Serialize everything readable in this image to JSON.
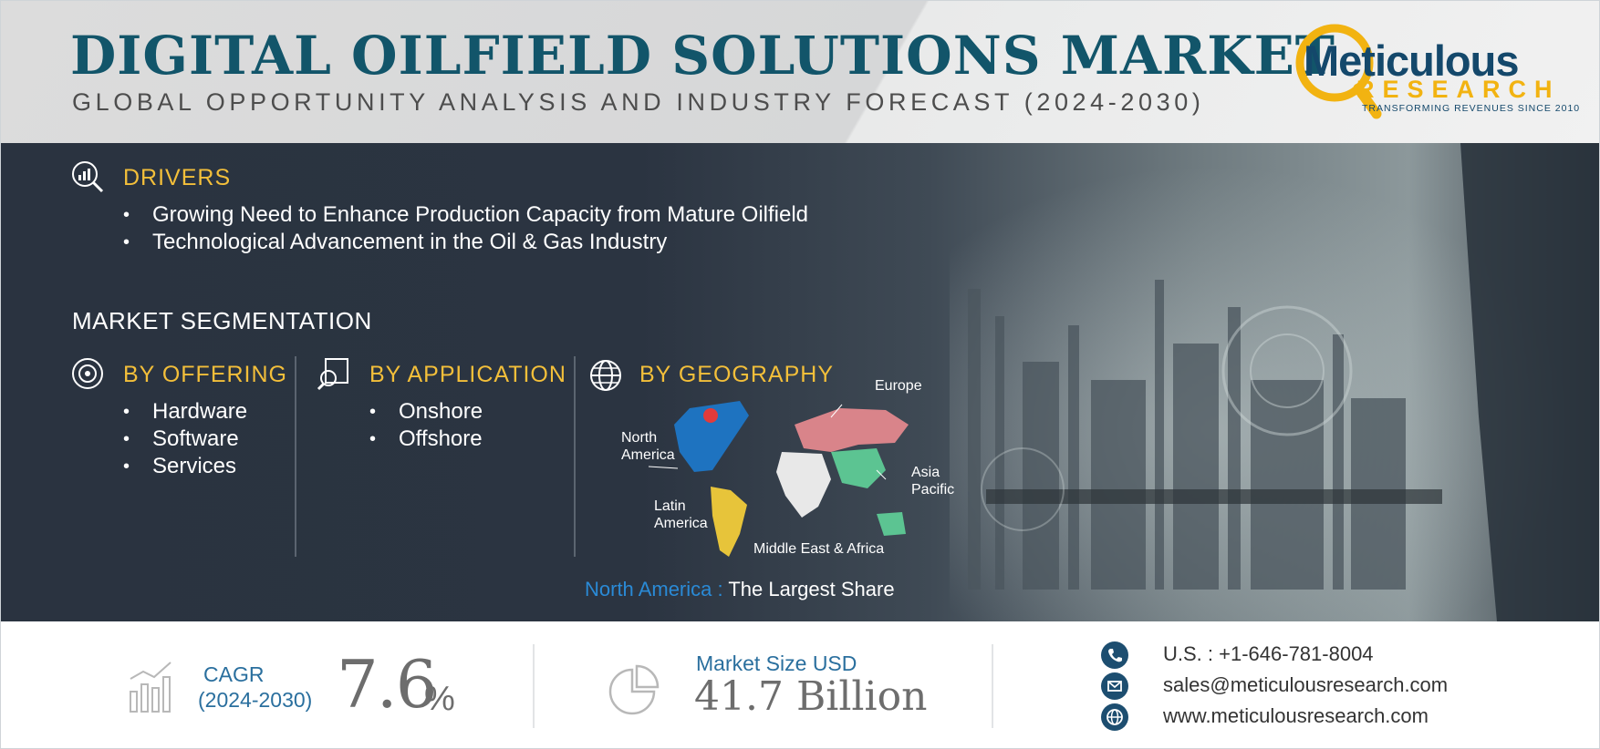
{
  "header": {
    "title": "DIGITAL OILFIELD SOLUTIONS MARKET",
    "subtitle": "GLOBAL OPPORTUNITY ANALYSIS AND INDUSTRY FORECAST (2024-2030)"
  },
  "logo": {
    "name": "Meticulous",
    "research": "RESEARCH",
    "tagline": "TRANSFORMING REVENUES SINCE 2010"
  },
  "drivers": {
    "heading": "DRIVERS",
    "items": [
      "Growing Need to Enhance Production Capacity from Mature Oilfield",
      "Technological Advancement in the Oil & Gas Industry"
    ]
  },
  "segmentation": {
    "title": "MARKET SEGMENTATION",
    "offering": {
      "heading": "BY OFFERING",
      "items": [
        "Hardware",
        "Software",
        "Services"
      ]
    },
    "application": {
      "heading": "BY APPLICATION",
      "items": [
        "Onshore",
        "Offshore"
      ]
    },
    "geography": {
      "heading": "BY GEOGRAPHY",
      "regions": {
        "europe": "Europe",
        "north_america_1": "North",
        "north_america_2": "America",
        "asia_1": "Asia",
        "asia_2": "Pacific",
        "latin_1": "Latin",
        "latin_2": "America",
        "mea": "Middle East & Africa"
      },
      "largest_region": "North America :",
      "largest_text": "The Largest Share"
    }
  },
  "stats": {
    "cagr_label": "CAGR",
    "cagr_years": "(2024-2030)",
    "cagr_value": "7.6",
    "cagr_unit": "%",
    "market_size_label": "Market Size USD",
    "market_size_value": "41.7 Billion"
  },
  "contact": {
    "phone": "U.S. : +1-646-781-8004",
    "email": "sales@meticulousresearch.com",
    "website": "www.meticulousresearch.com"
  },
  "colors": {
    "title": "#12556a",
    "accent_yellow": "#f3bf3a",
    "accent_blue": "#2a8ad6",
    "dark_bg": "#2b3441"
  }
}
